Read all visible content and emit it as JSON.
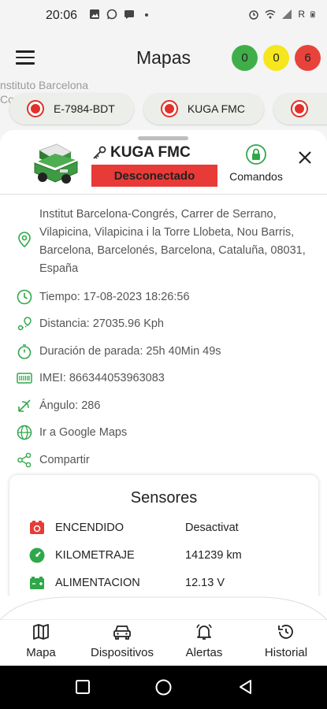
{
  "status_bar": {
    "time": "20:06",
    "network_label": "R"
  },
  "header": {
    "title": "Mapas",
    "counters": [
      {
        "value": "0",
        "color": "#3fae49"
      },
      {
        "value": "0",
        "color": "#f5e61d"
      },
      {
        "value": "6",
        "color": "#e8433a"
      }
    ]
  },
  "map": {
    "background_text": "nstituto Barcelona\nCo"
  },
  "chips": [
    {
      "label": "E-7984-BDT",
      "icon": "record-icon"
    },
    {
      "label": "KUGA FMC",
      "icon": "record-icon"
    },
    {
      "label": "",
      "icon": "record-icon"
    }
  ],
  "vehicle": {
    "name": "KUGA FMC",
    "status": "Desconectado",
    "commands_label": "Comandos",
    "address": "Institut Barcelona-Congrés, Carrer de Serrano, Vilapicina, Vilapicina i la Torre Llobeta, Nou Barris, Barcelona, Barcelonés, Barcelona, Cataluña, 08031, España",
    "time": "Tiempo: 17-08-2023 18:26:56",
    "distance": "Distancia: 27035.96 Kph",
    "stop_duration": "Duración de parada: 25h 40Min 49s",
    "imei": "IMEI: 866344053963083",
    "angle": "Ángulo: 286",
    "google_maps": "Ir a Google Maps",
    "share": "Compartir"
  },
  "sensors": {
    "title": "Sensores",
    "rows": [
      {
        "name": "ENCENDIDO",
        "value": "Desactivat",
        "icon": "ignition-icon"
      },
      {
        "name": "KILOMETRAJE",
        "value": "141239 km",
        "icon": "odometer-icon"
      },
      {
        "name": "ALIMENTACION",
        "value": "12.13 V",
        "icon": "battery-icon"
      }
    ]
  },
  "bottom_nav": [
    {
      "label": "Mapa",
      "icon": "map-icon"
    },
    {
      "label": "Dispositivos",
      "icon": "car-icon"
    },
    {
      "label": "Alertas",
      "icon": "bell-icon"
    },
    {
      "label": "Historial",
      "icon": "history-icon"
    }
  ],
  "colors": {
    "accent_green": "#2fa84a",
    "danger_red": "#e83a37"
  }
}
